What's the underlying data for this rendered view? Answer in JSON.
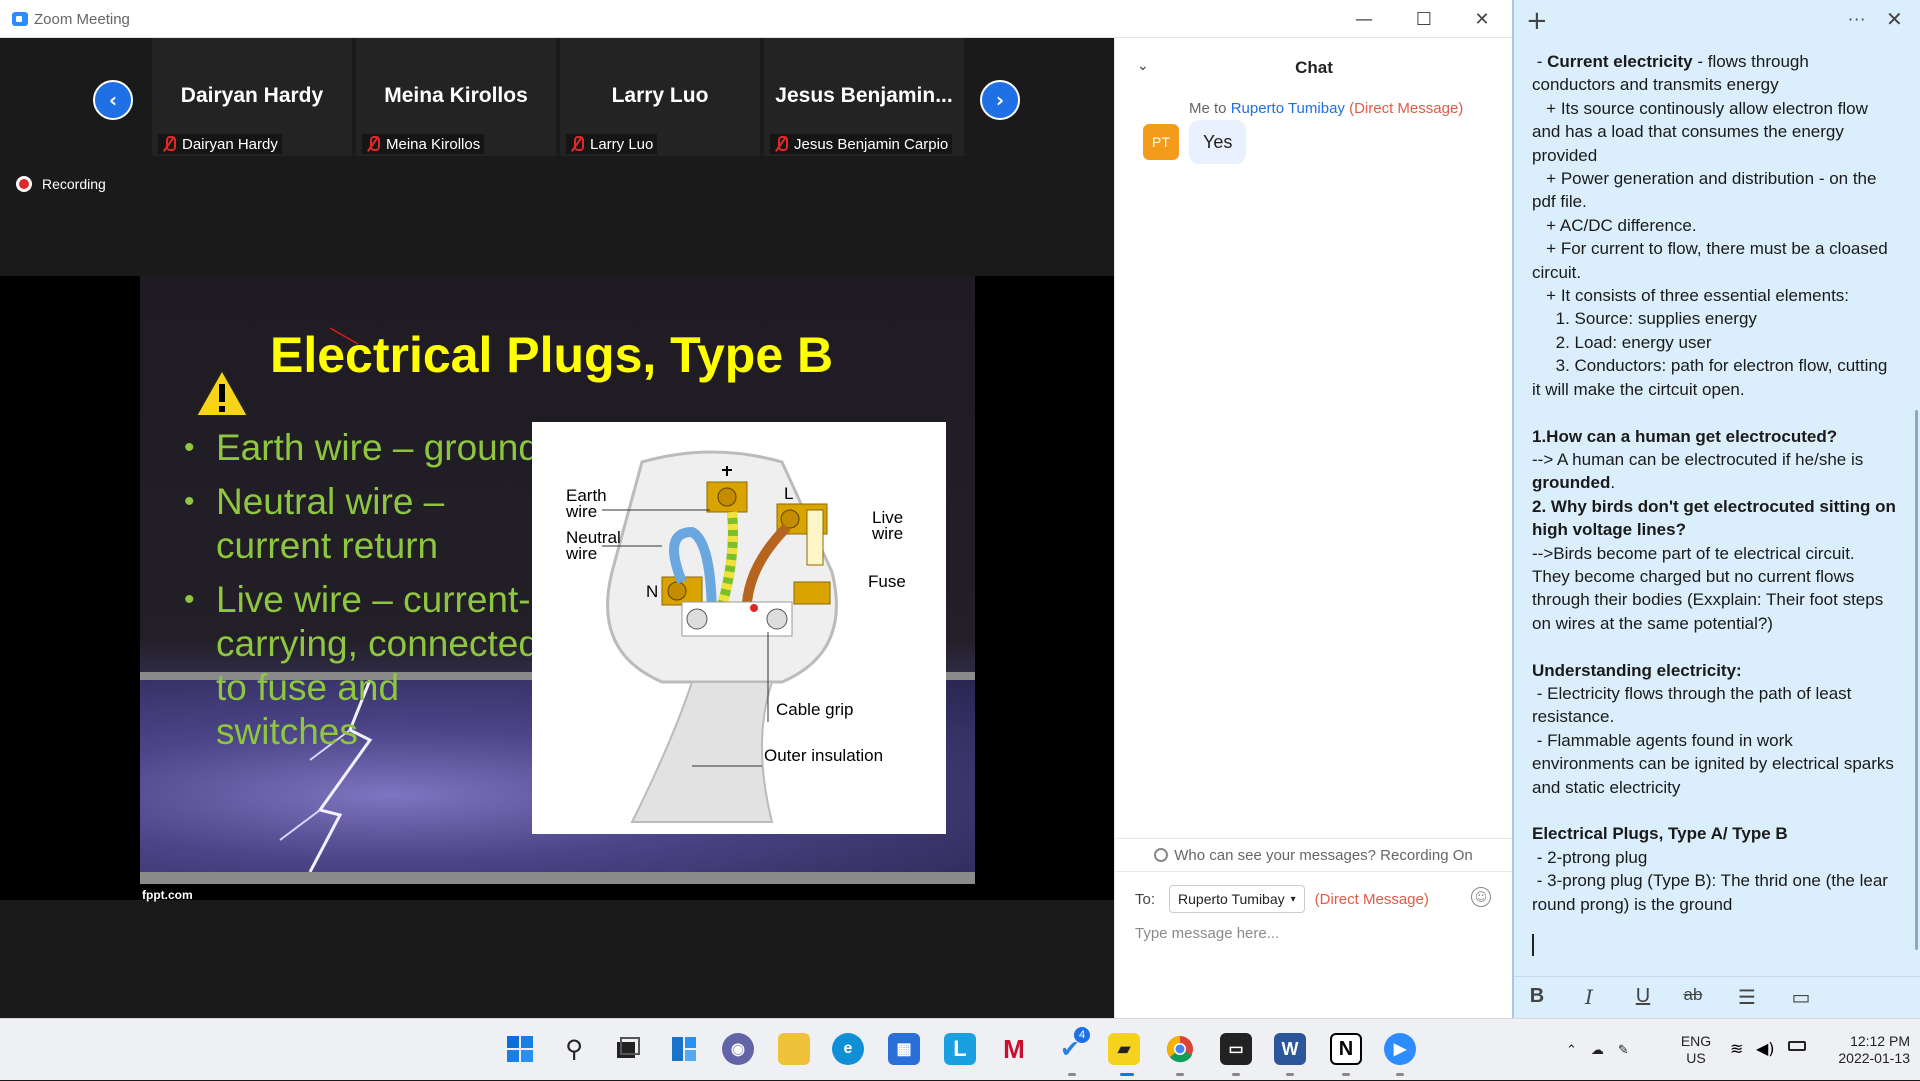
{
  "zoom": {
    "window_title": "Zoom Meeting",
    "recording_label": "Recording",
    "participants": [
      {
        "display": "Dairyan Hardy",
        "name": "Dairyan Hardy"
      },
      {
        "display": "Meina Kirollos",
        "name": "Meina Kirollos"
      },
      {
        "display": "Larry Luo",
        "name": "Larry Luo"
      },
      {
        "display": "Jesus  Benjamin...",
        "name": "Jesus Benjamin Carpio"
      }
    ],
    "slide": {
      "title": "Electrical Plugs, Type B",
      "bullets": [
        "Earth wire – ground",
        "Neutral wire – current return",
        "Live wire – current-carrying, connected to fuse and switches"
      ],
      "footer": "fppt.com",
      "diagram_labels": {
        "earth": "Earth wire",
        "neutral": "Neutral wire",
        "live": "Live wire",
        "fuse": "Fuse",
        "cable_grip": "Cable grip",
        "outer": "Outer insulation",
        "n": "N",
        "l": "L"
      }
    }
  },
  "chat": {
    "title": "Chat",
    "meta_prefix": "Me to ",
    "meta_to": "Ruperto Tumibay",
    "meta_dm": "(Direct Message)",
    "avatar_initials": "PT",
    "message": "Yes",
    "who_can_see": "Who can see your messages? Recording On",
    "to_label": "To:",
    "to_recipient": "Ruperto Tumibay",
    "to_dm": "(Direct Message)",
    "input_placeholder": "Type message here..."
  },
  "notes": {
    "menu": "···",
    "lines": [
      {
        "parts": [
          {
            "t": " - "
          },
          {
            "t": "Current electricity",
            "b": true
          },
          {
            "t": " - flows through"
          }
        ]
      },
      {
        "parts": [
          {
            "t": "conductors and transmits energy"
          }
        ]
      },
      {
        "parts": [
          {
            "t": "   + Its source continously allow electron flow"
          }
        ]
      },
      {
        "parts": [
          {
            "t": "and has a load that consumes the energy"
          }
        ]
      },
      {
        "parts": [
          {
            "t": "provided"
          }
        ]
      },
      {
        "parts": [
          {
            "t": "   + Power generation and distribution - on the"
          }
        ]
      },
      {
        "parts": [
          {
            "t": "pdf file."
          }
        ]
      },
      {
        "parts": [
          {
            "t": "   + AC/DC difference."
          }
        ]
      },
      {
        "parts": [
          {
            "t": "   + For current to flow, there must be a cloased"
          }
        ]
      },
      {
        "parts": [
          {
            "t": "circuit."
          }
        ]
      },
      {
        "parts": [
          {
            "t": "   + It consists of three essential elements:"
          }
        ]
      },
      {
        "parts": [
          {
            "t": "     1. Source: supplies energy"
          }
        ]
      },
      {
        "parts": [
          {
            "t": "     2. Load: energy user"
          }
        ]
      },
      {
        "parts": [
          {
            "t": "     3. Conductors: path for electron flow, cutting"
          }
        ]
      },
      {
        "parts": [
          {
            "t": "it will make the cirtcuit open."
          }
        ]
      },
      {
        "parts": [
          {
            "t": " "
          }
        ]
      },
      {
        "parts": [
          {
            "t": "1.How can a human get electrocuted?",
            "b": true
          }
        ]
      },
      {
        "parts": [
          {
            "t": "--> A human can be electrocuted if he/she is"
          }
        ]
      },
      {
        "parts": [
          {
            "t": "grounded",
            "b": true
          },
          {
            "t": "."
          }
        ]
      },
      {
        "parts": [
          {
            "t": "2. Why birds don't get electrocuted sitting on",
            "b": true
          }
        ]
      },
      {
        "parts": [
          {
            "t": "high voltage lines?",
            "b": true
          }
        ]
      },
      {
        "parts": [
          {
            "t": "-->Birds become part of te electrical circuit."
          }
        ]
      },
      {
        "parts": [
          {
            "t": "They become charged but no current flows"
          }
        ]
      },
      {
        "parts": [
          {
            "t": "through their bodies (Exxplain: Their foot steps"
          }
        ]
      },
      {
        "parts": [
          {
            "t": "on wires at the same potential?)"
          }
        ]
      },
      {
        "parts": [
          {
            "t": " "
          }
        ]
      },
      {
        "parts": [
          {
            "t": "Understanding electricity:",
            "b": true
          }
        ]
      },
      {
        "parts": [
          {
            "t": " - Electricity flows through the path of least"
          }
        ]
      },
      {
        "parts": [
          {
            "t": "resistance."
          }
        ]
      },
      {
        "parts": [
          {
            "t": " - Flammable agents found in work"
          }
        ]
      },
      {
        "parts": [
          {
            "t": "environments can be ignited by electrical sparks"
          }
        ]
      },
      {
        "parts": [
          {
            "t": "and static electricity"
          }
        ]
      },
      {
        "parts": [
          {
            "t": " "
          }
        ]
      },
      {
        "parts": [
          {
            "t": "Electrical Plugs, Type A/ Type B",
            "b": true
          }
        ]
      },
      {
        "parts": [
          {
            "t": " - 2-ptrong plug"
          }
        ]
      },
      {
        "parts": [
          {
            "t": " - 3-prong plug (Type B): The thrid one (the lear"
          }
        ]
      },
      {
        "parts": [
          {
            "t": "round prong) is the ground"
          }
        ]
      }
    ],
    "format_buttons": {
      "bold": "B",
      "italic": "I",
      "underline": "U",
      "strike": "ab",
      "list": "☰",
      "image": "▭"
    }
  },
  "taskbar": {
    "badge_count": "4",
    "lang_top": "ENG",
    "lang_bottom": "US",
    "time": "12:12 PM",
    "date": "2022-01-13"
  }
}
